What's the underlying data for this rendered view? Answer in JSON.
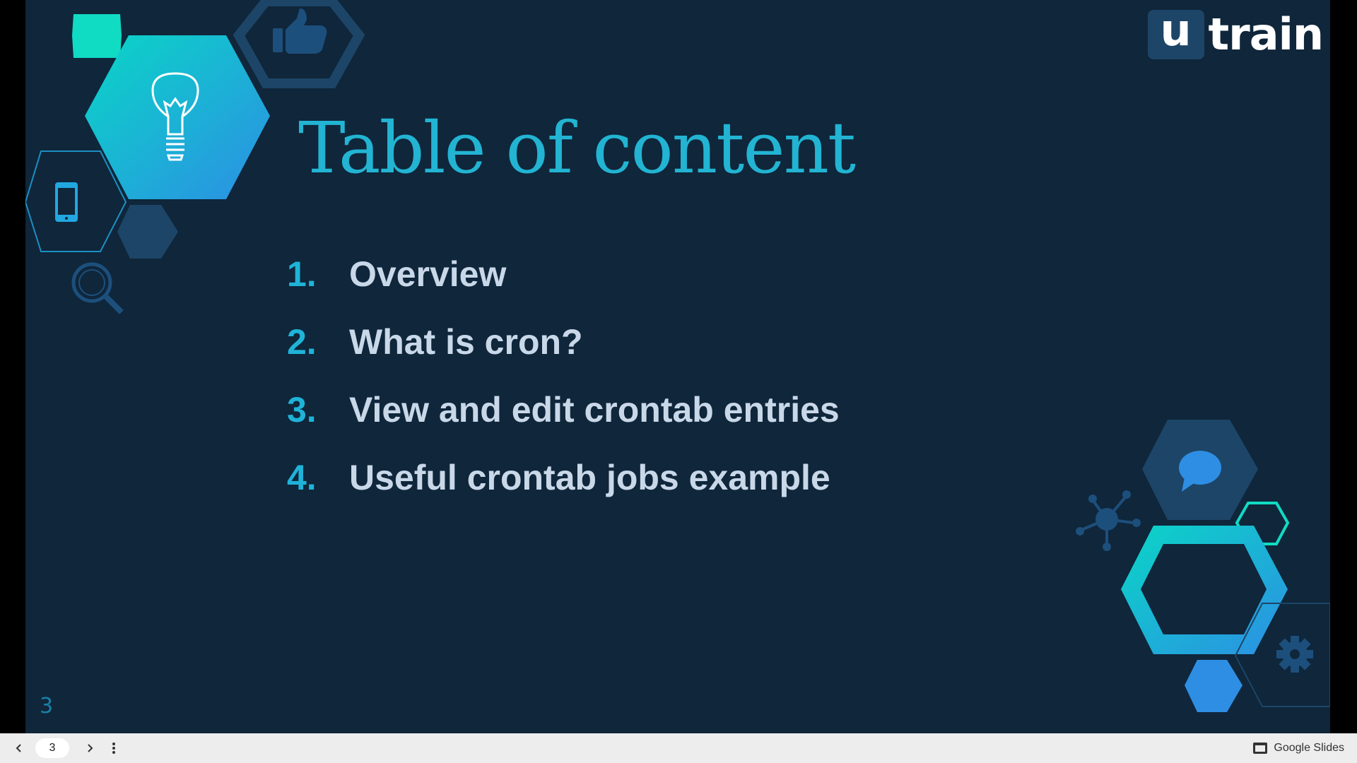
{
  "logo": {
    "box_letter": "u",
    "word": "train"
  },
  "slide": {
    "title": "Table of content",
    "items": [
      {
        "num": "1.",
        "text": "Overview"
      },
      {
        "num": "2.",
        "text": "What is cron?"
      },
      {
        "num": "3.",
        "text": "View and edit crontab entries"
      },
      {
        "num": "4.",
        "text": "Useful crontab jobs example"
      }
    ],
    "page_number": "3"
  },
  "toolbar": {
    "current_page": "3",
    "brand": "Google Slides"
  },
  "icons": [
    "lightbulb-icon",
    "thumbs-up-icon",
    "smartphone-icon",
    "magnifier-icon",
    "chat-bubble-icon",
    "network-icon",
    "gear-icon",
    "presentation-icon",
    "chevron-left-icon",
    "chevron-right-icon",
    "more-vertical-icon"
  ],
  "colors": {
    "background": "#0f263b",
    "accent": "#22b4d2",
    "text": "#c9d8e8"
  }
}
